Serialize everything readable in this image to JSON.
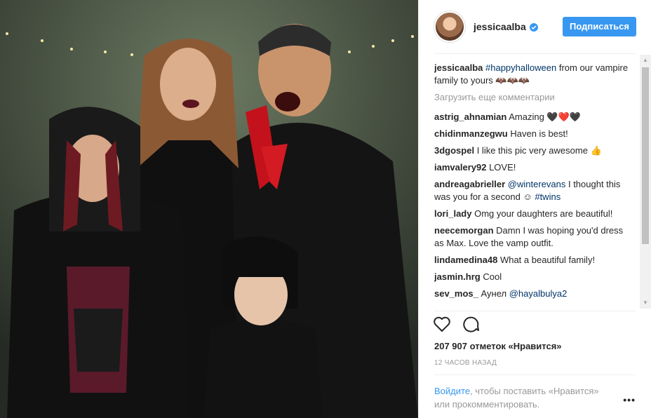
{
  "header": {
    "username": "jessicaalba",
    "follow_label": "Подписаться"
  },
  "caption": {
    "user": "jessicaalba",
    "hashtag": "#happyhalloween",
    "text": " from our vampire family to yours 🦇🦇🦇"
  },
  "load_more": "Загрузить еще комментарии",
  "comments": [
    {
      "user": "astrig_ahnamian",
      "text": "Amazing 🖤❤️🖤"
    },
    {
      "user": "chidinmanzegwu",
      "text": "Haven is best!"
    },
    {
      "user": "3dgospel",
      "text": "I like this pic very awesome 👍"
    },
    {
      "user": "iamvalery92",
      "text": "LOVE!"
    },
    {
      "user": "andreagabrieller",
      "mention": "@winterevans",
      "text": " I thought this was you for a second ☺ ",
      "hashtag": "#twins"
    },
    {
      "user": "lori_lady",
      "text": "Omg your daughters are beautiful!"
    },
    {
      "user": "neecemorgan",
      "text": "Damn I was hoping you'd dress as Max. Love the vamp outfit."
    },
    {
      "user": "lindamedina48",
      "text": "What a beautiful family!"
    },
    {
      "user": "jasmin.hrg",
      "text": "Cool"
    },
    {
      "user": "sev_mos_",
      "text": "Аунел ",
      "mention": "@hayalbulya2"
    }
  ],
  "likes_text": "207 907 отметок «Нравится»",
  "time_text": "12 ЧАСОВ НАЗАД",
  "login": {
    "link": "Войдите",
    "text": ", чтобы поставить «Нравится» или прокомментировать."
  },
  "more_label": "•••",
  "icons": [
    "heart-icon",
    "comment-icon",
    "verified-icon"
  ],
  "colors": {
    "accent": "#3897f0",
    "tag": "#003569",
    "muted": "#999999"
  }
}
